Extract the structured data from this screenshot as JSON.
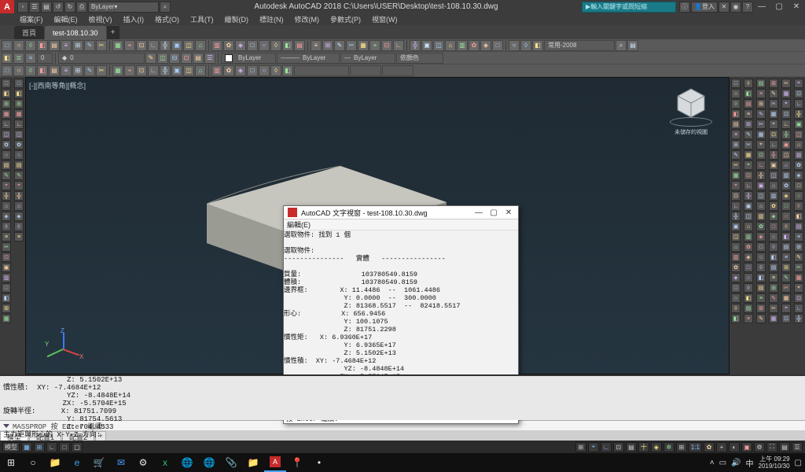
{
  "titlebar": {
    "logo": "A",
    "qa_icons": [
      "▫",
      "☰",
      "▤",
      "↺",
      "↻",
      "⎙",
      "⌕"
    ],
    "layer_dropdown": "ByLayer",
    "title": "Autodesk AutoCAD 2018   C:\\Users\\USER\\Desktop\\test-108.10.30.dwg",
    "search_placeholder": "輸入關鍵字或問短縮",
    "login": "登入",
    "min": "—",
    "max": "▢",
    "close": "✕"
  },
  "menubar": [
    "檔案(F)",
    "編輯(E)",
    "檢視(V)",
    "插入(I)",
    "格式(O)",
    "工具(T)",
    "繪製(D)",
    "標註(N)",
    "修改(M)",
    "參數式(P)",
    "視窗(W)"
  ],
  "doctabs": {
    "home": "首頁",
    "active": "test-108.10.30",
    "plus": "+"
  },
  "toolbars": {
    "r1": {
      "n": 44
    },
    "r2": {
      "head": 3,
      "num": "0",
      "drop1": "0",
      "mid_icons": 6,
      "bylayer": "ByLayer",
      "byl2": "ByLayer",
      "byl3": "ByLayer",
      "bycolor": "依顏色"
    },
    "r3": {
      "n": 24
    },
    "row1_right_drop": "常用-2008"
  },
  "view_label": "[-][西南等角][概念]",
  "axis": {
    "x": "X",
    "y": "Y",
    "z": "Z"
  },
  "viewcube": {
    "label": "未儲存的視圖"
  },
  "popup": {
    "title": "AutoCAD 文字視窗 - test-108.10.30.dwg",
    "menu": "編輯(E)",
    "lines": [
      "選取物件: 找到 1 個",
      "",
      "選取物件:",
      "---------------   實體   ----------------",
      "",
      "質量:               103780549.8159",
      "體積:               103780549.8159",
      "邊界框:        X: 11.4486  --  1061.4486",
      "               Y: 0.0000  --  300.0000",
      "               Z: 81368.5517  --  82418.5517",
      "形心:          X: 656.9456",
      "               Y: 100.1075",
      "               Z: 81751.2298",
      "慣性矩:   X: 6.9360E+17",
      "               Y: 6.9365E+17",
      "               Z: 5.1502E+13",
      "慣性積:  XY: -7.4684E+12",
      "               YZ: -8.4848E+14",
      "              ZX: -5.5704E+15",
      "旋轉半徑:      X: 81751.7099",
      "               Y: 81754.5613",
      "               Z: 704.4533",
      "主力矩與形心的 X-Y-Z 方向:"
    ],
    "input": "按 Enter 繼續:"
  },
  "cmd_history": [
    "               Z: 5.1502E+13",
    "慣性積:  XY: -7.4684E+12",
    "               YZ: -8.4848E+14",
    "              ZX: -5.5704E+15",
    "旋轉半徑:      X: 81751.7099",
    "               Y: 81754.5613",
    "               Z: 704.4533",
    "主力矩與形心的 X-Y-Z 方向:"
  ],
  "cmd_line": "MASSPROP 按 Enter 繼續:",
  "layout_tabs": [
    "模型",
    "配置1",
    "配置2"
  ],
  "status": {
    "left": [
      "模型",
      "▦",
      "⊞",
      "∟",
      "□",
      "▢"
    ],
    "right": [
      "⊞",
      "⌖",
      "∟",
      "⊡",
      "▤",
      "十",
      "◈",
      "✲",
      "⊞",
      "1:1",
      "✿",
      "+",
      "◐",
      "▣",
      "⚙",
      "⛶",
      "▤",
      "☰"
    ]
  },
  "taskbar": {
    "icons": [
      "⊞",
      "○",
      "📁",
      "e",
      "🛒",
      "✉",
      "⚙",
      "x",
      "🌐",
      "🌐",
      "📎",
      "📁",
      "A",
      "📍",
      "•"
    ],
    "clock_top": "上午 09:29",
    "clock_bottom": "2019/10/30"
  },
  "left_palette_count": 24,
  "right_columns": 6,
  "right_rows": 24
}
